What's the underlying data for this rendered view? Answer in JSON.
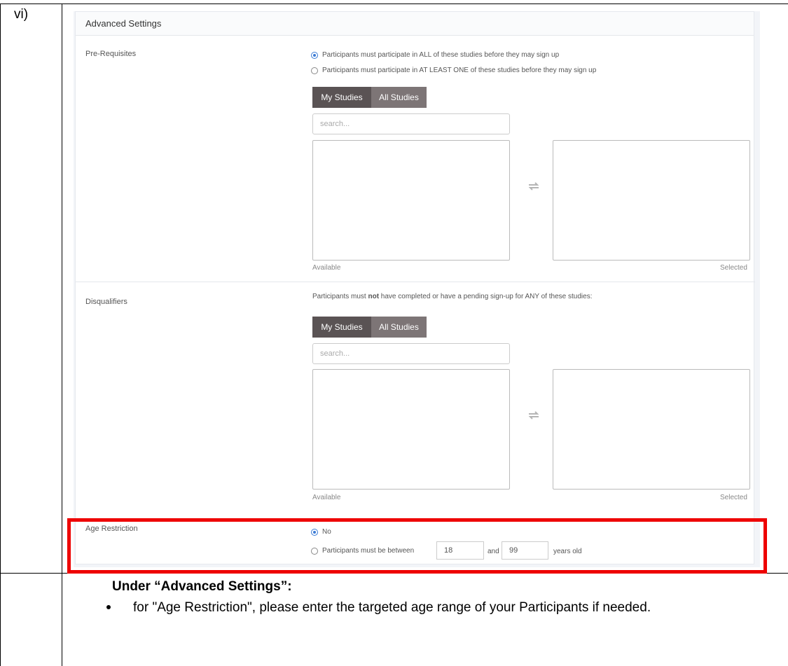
{
  "step_label": "vi)",
  "panel": {
    "title": "Advanced Settings"
  },
  "prerequisites": {
    "label": "Pre-Requisites",
    "options": [
      {
        "label": "Participants must participate in ALL of these studies before they may sign up",
        "checked": true
      },
      {
        "label": "Participants must participate in AT LEAST ONE of these studies before they may sign up",
        "checked": false
      }
    ],
    "tabs": [
      "My Studies",
      "All Studies"
    ],
    "search_placeholder": "search...",
    "available_label": "Available",
    "selected_label": "Selected"
  },
  "disqualifiers": {
    "label": "Disqualifiers",
    "description_before": "Participants must ",
    "description_bold": "not",
    "description_after": " have completed or have a pending sign-up for ANY of these studies:",
    "tabs": [
      "My Studies",
      "All Studies"
    ],
    "search_placeholder": "search...",
    "available_label": "Available",
    "selected_label": "Selected"
  },
  "age_restriction": {
    "label": "Age Restriction",
    "option_no": "No",
    "option_between": "Participants must be between",
    "min_age": "18",
    "and_text": "and",
    "max_age": "99",
    "suffix": "years old"
  },
  "instructions": {
    "title": "Under “Advanced Settings”:",
    "bullet": "for \"Age Restriction\", please enter the targeted age range of your Participants if needed."
  },
  "colors": {
    "highlight_border": "#ee0000",
    "tab_active": "#5a5354",
    "tab_inactive": "#7d7576",
    "radio_checked": "#3a7bd5"
  }
}
